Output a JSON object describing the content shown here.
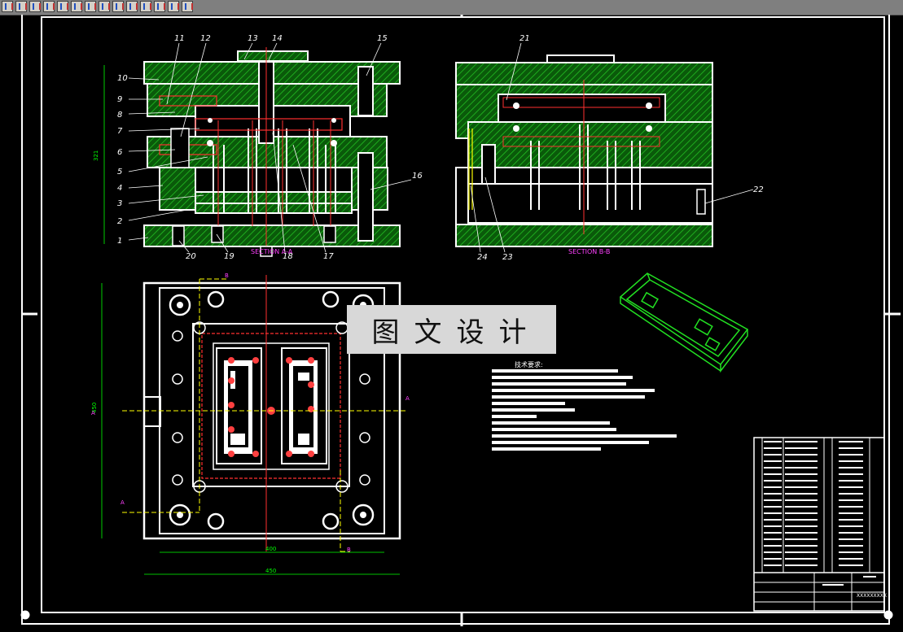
{
  "app": {
    "toolbar": {
      "buttons": [
        "line-tool-icon",
        "polyline-tool-icon",
        "circle-tool-icon",
        "arc-tool-icon",
        "rectangle-tool-icon",
        "hatch-tool-icon",
        "dimension-tool-icon",
        "move-tool-icon",
        "pan-tool-icon",
        "zoom-tool-icon",
        "layer-tool-icon",
        "text-tool-icon",
        "properties-tool-icon",
        "block-tool-icon"
      ]
    }
  },
  "drawing": {
    "watermark": "图文设计",
    "section_aa_label": "SECTION A-A",
    "section_bb_label": "SECTION B-B",
    "tech_requirements_title": "技术要求:",
    "part_numbers_left": [
      "1",
      "2",
      "3",
      "4",
      "5",
      "6",
      "7",
      "8",
      "9",
      "10",
      "11",
      "12",
      "13",
      "14",
      "15",
      "16",
      "17",
      "18",
      "19",
      "20"
    ],
    "part_numbers_right": [
      "21",
      "22",
      "23",
      "24"
    ],
    "dimensions": {
      "height_left": "321",
      "plan_height": "450",
      "plan_width_inner": "400",
      "plan_width_outer": "450"
    },
    "section_marks": {
      "a": "A",
      "b": "B"
    },
    "drawing_number": "XXXXXXXXX",
    "colors": {
      "hatch": "#00a000",
      "outline": "#ffffff",
      "centerline": "#ff3030",
      "dimension": "#00ff00",
      "label": "#ff40ff",
      "leader": "#ffff00"
    }
  }
}
